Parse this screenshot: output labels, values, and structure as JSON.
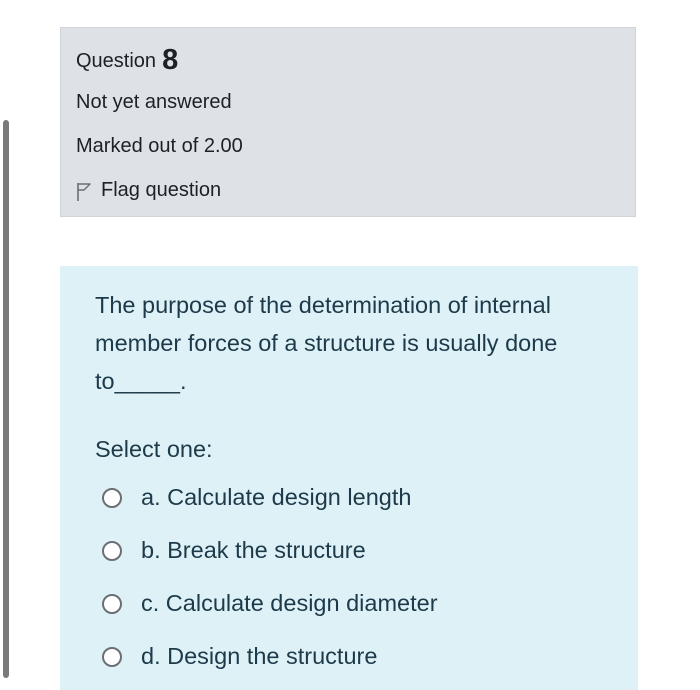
{
  "question_info": {
    "question_label": "Question",
    "question_number": "8",
    "state": "Not yet answered",
    "grade": "Marked out of 2.00",
    "flag_label": "Flag question"
  },
  "question": {
    "text": "The purpose of the determination of internal member forces of a structure is usually done to_____.",
    "prompt": "Select one:",
    "options": [
      {
        "label": "a. Calculate design length"
      },
      {
        "label": "b. Break the structure"
      },
      {
        "label": "c. Calculate design diameter"
      },
      {
        "label": "d. Design the structure"
      }
    ]
  },
  "colors": {
    "info_background": "#dee2e6",
    "content_background": "#def1f7",
    "text": "#1d2125"
  }
}
